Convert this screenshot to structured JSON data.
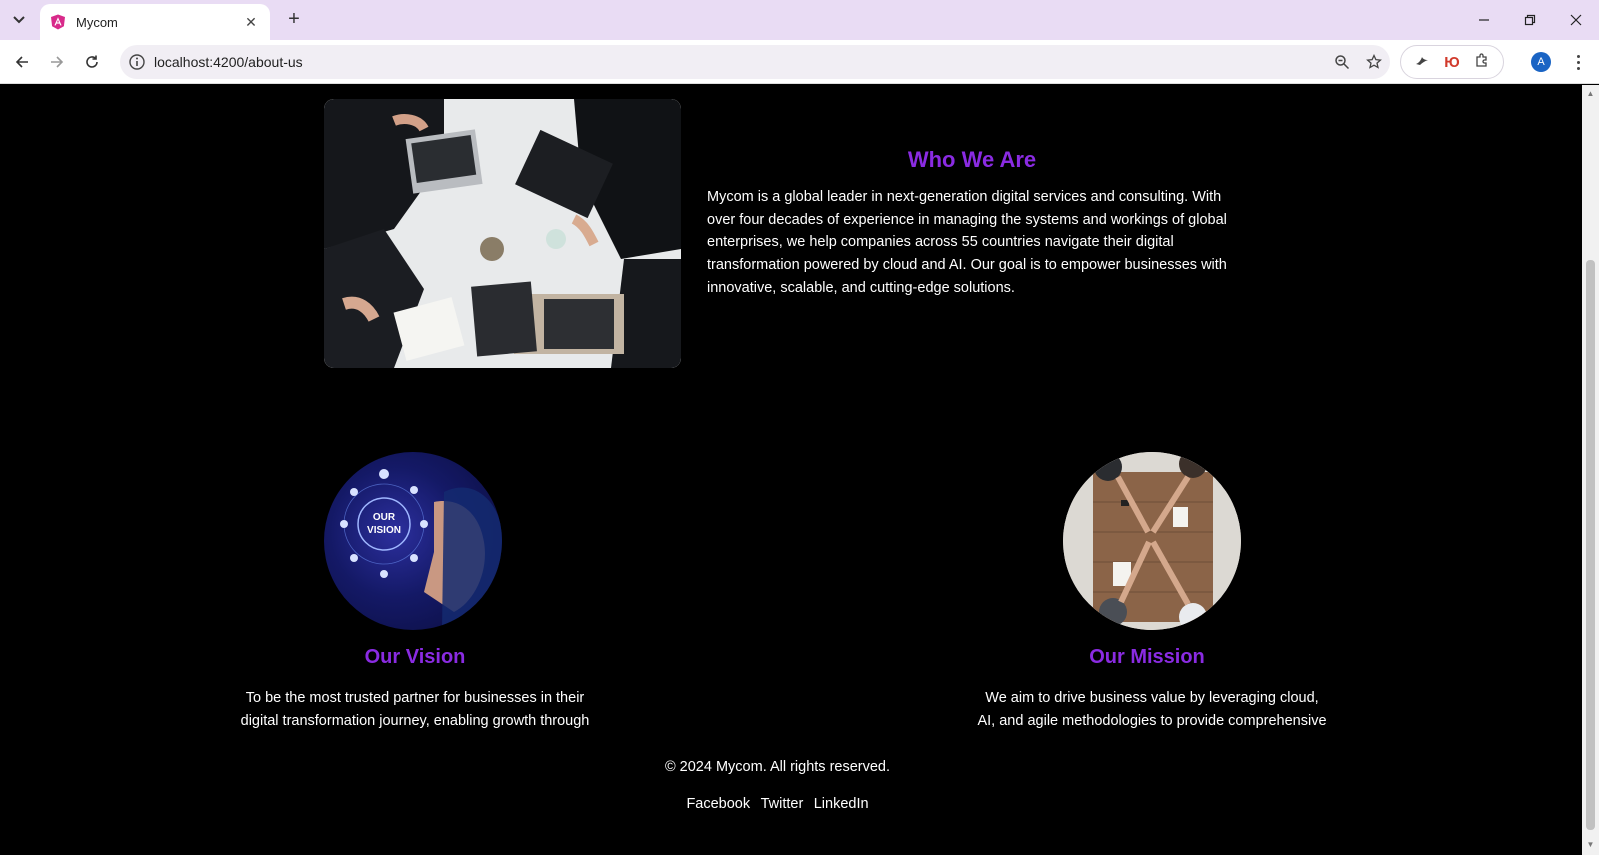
{
  "browser": {
    "tab_title": "Mycom",
    "url": "localhost:4200/about-us",
    "new_tab": "+",
    "profile_initial": "A",
    "ext_yu": "Ю"
  },
  "about": {
    "who_title": "Who We Are",
    "who_text": "Mycom is a global leader in next-generation digital services and consulting. With over four decades of experience in managing the systems and workings of global enterprises, we help companies across 55 countries navigate their digital transformation powered by cloud and AI. Our goal is to empower businesses with innovative, scalable, and cutting-edge solutions.",
    "vision_badge_line1": "OUR",
    "vision_badge_line2": "VISION",
    "vision_title": "Our Vision",
    "vision_text": "To be the most trusted partner for businesses in their digital transformation journey, enabling growth through",
    "mission_title": "Our Mission",
    "mission_text": "We aim to drive business value by leveraging cloud, AI, and agile methodologies to provide comprehensive"
  },
  "footer": {
    "copyright": "© 2024 Mycom. All rights reserved.",
    "links": [
      "Facebook",
      "Twitter",
      "LinkedIn"
    ]
  },
  "colors": {
    "accent": "#8a2be2",
    "background": "#000000",
    "tabbar": "#e9dcf4"
  }
}
